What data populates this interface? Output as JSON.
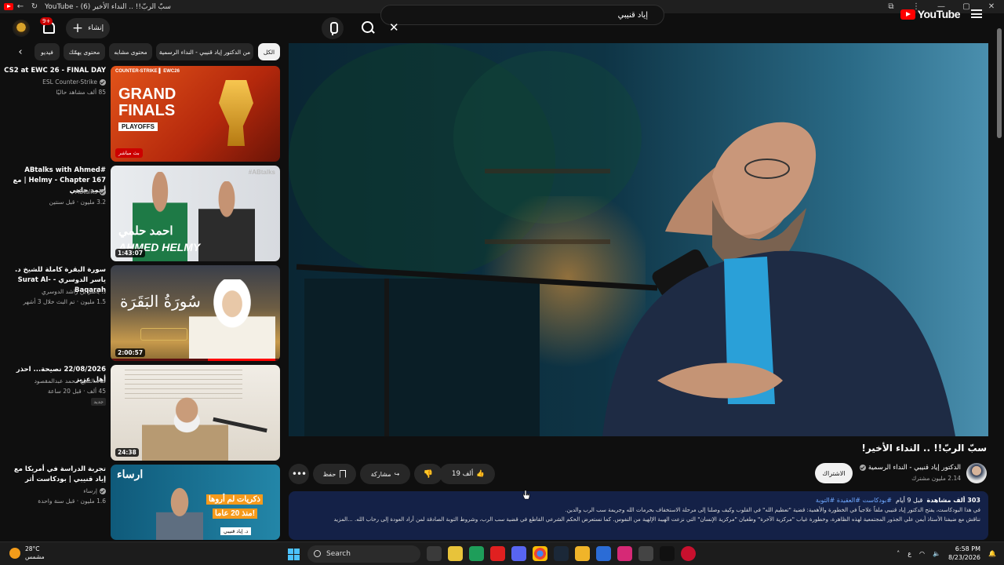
{
  "window": {
    "title": "YouTube - (6) سبّ الربّ!! .. النداء الأخير",
    "controls": [
      "—",
      "▢",
      "✕"
    ]
  },
  "masthead": {
    "logo_text": "YouTube",
    "search_value": "إياد قنيبي",
    "create_label": "إنشاء",
    "notification_count": "9+"
  },
  "chips": [
    {
      "label": "الكل",
      "active": true
    },
    {
      "label": "من الدكتور إياد قنيبي - النداء الرسمية",
      "active": false
    },
    {
      "label": "محتوى مشابه",
      "active": false
    },
    {
      "label": "محتوى يهمّك",
      "active": false
    },
    {
      "label": "فيديو",
      "active": false
    }
  ],
  "recommendations": [
    {
      "title": "CS2 at EWC 26 - FINAL DAY",
      "channel": "ESL Counter-Strike",
      "meta": "85 ألف مشاهد حاليًا",
      "badge": "بث مباشر",
      "thumb_text": [
        "GRAND",
        "FINALS",
        "PLAYOFFS"
      ]
    },
    {
      "title": "#ABtalks with Ahmed Helmy - Chapter 167 | مع أحمد حلمي",
      "channel": "ABtalks",
      "meta": "3.2 مليون · قبل سنتين",
      "duration": "1:43:07",
      "thumb_text": [
        "احمد حلمي",
        "AHMED HELMY",
        "#ABtalks"
      ]
    },
    {
      "title": "سورة البقرة كاملة للشيخ د. ياسر الدوسري - Surat Al-Baqarah",
      "channel": "د. ياسر بن راشد الدوسري",
      "meta": "1.5 مليون · تم البث خلال 3 أشهر",
      "duration": "2:00:57",
      "thumb_text": [
        "سُورَةُ البَقَرَة"
      ]
    },
    {
      "title": "22/08/2026 نصيحة... احذر أهل عزيز",
      "channel": "قناة الشيخ محمد عبدالمقصود",
      "meta": "45 ألف · قبل 20 ساعة",
      "badge": "جديد",
      "duration": "24:38"
    },
    {
      "title": "تجربة الدراسة في أمريكا مع إياد قنيبي | بودكاست أثر",
      "channel": "إرساء",
      "meta": "1.6 مليون · قبل سنة واحدة",
      "thumb_text": [
        "ارساء",
        "ذكريات لم أروها",
        "منذ 20 عاما!",
        "د. إياد قنيبي"
      ]
    }
  ],
  "video": {
    "title": "سبّ الربّ!! .. النداء الأخير!",
    "channel": "الدكتور إياد قنيبي - النداء الرسمية",
    "subscribers": "2.14 مليون مشترك",
    "subscribe_label": "الاشتراك",
    "likes": "19 ألف",
    "share_label": "مشاركة",
    "save_label": "حفظ",
    "views": "303 ألف مشاهدة",
    "age": "قبل 9 أيام",
    "tags": "#بودكاست #العقيدة #التوبة",
    "description_line1": "في هذا البودكاست، يفتح الدكتور إياد قنيبي ملفاً علاجياً في الخطورة والأهمية: قضية \"تعظيم الله\" في القلوب وكيف وصلنا إلى مرحلة الاستخفاف بحرمات الله وجريمة سب الرب والدين.",
    "description_line2": "نناقش مع ضيفنا الأستاذ أيمن علي الجذور المجتمعية لهذه الظاهرة، وخطورة غياب \"مركزية الآخرة\" وطغيان \"مركزية الإنسان\" التي نزعت الهيبة الإلهية من النفوس. كما نستعرض الحكم الشرعي القاطع في قضية سب الرب، وشروط التوبة الصادقة لمن أراد العودة إلى رحاب الله. ...المزيد"
  },
  "taskbar": {
    "temperature": "28°C",
    "condition": "مشمس",
    "search_label": "Search",
    "time": "6:58 PM",
    "date": "8/23/2026",
    "lang": "ع"
  },
  "colors": {
    "background": "#0f0f0f",
    "accent_red": "#ff0000",
    "description_bg": "#142147",
    "chip_bg": "#272727"
  }
}
